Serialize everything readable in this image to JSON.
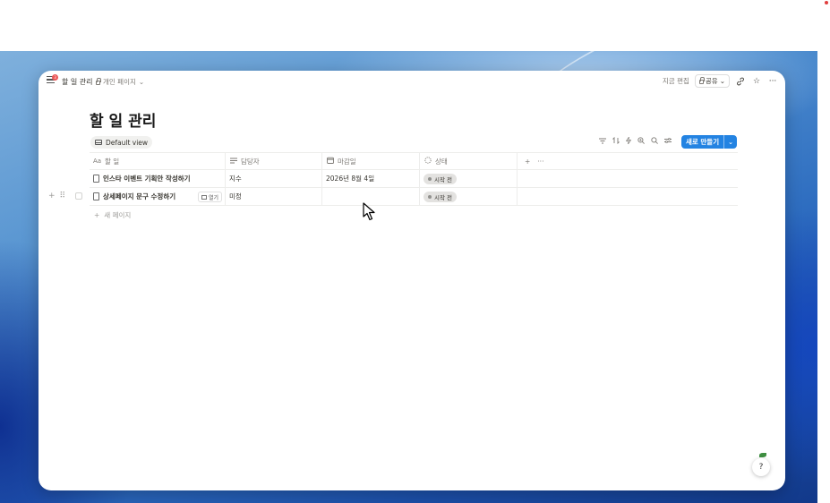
{
  "topbar": {
    "title": "할 일 관리",
    "privacy": "개인 페이지",
    "privacy_chevron": "⌄",
    "edited": "지금 편집",
    "share": "공유",
    "share_chevron": "⌄",
    "notification_count": "3"
  },
  "page": {
    "title": "할 일 관리"
  },
  "view": {
    "tab_label": "Default view",
    "new_button": "새로 만들기",
    "new_button_chevron": "⌄"
  },
  "table": {
    "headers": {
      "name": "할 일",
      "assignee": "담당자",
      "due": "마감일",
      "status": "상태"
    },
    "header_icons": {
      "name": "Aa",
      "add": "+",
      "more": "···"
    },
    "rows": [
      {
        "name": "인스타 이벤트 기획안 작성하기",
        "assignee": "지수",
        "due": "2026년 8월 4일",
        "status": "시작 전"
      },
      {
        "name": "상세페이지 문구 수정하기",
        "assignee": "미정",
        "due": "",
        "status": "시작 전",
        "open_label": "열기"
      }
    ],
    "new_page": "새 페이지"
  },
  "colors": {
    "accent": "#2383e2",
    "status_pill": "#e3e2e0",
    "notification": "#eb5757"
  }
}
